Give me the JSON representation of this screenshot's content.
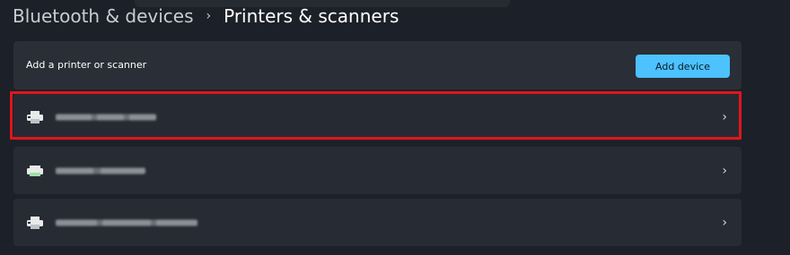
{
  "breadcrumb": {
    "parent": "Bluetooth & devices",
    "separator": "›",
    "current": "Printers & scanners"
  },
  "add_section": {
    "label": "Add a printer or scanner",
    "button_label": "Add device"
  },
  "devices": [
    {
      "name": "",
      "name_redacted": true,
      "icon": "printer-icon",
      "chevron": "›",
      "highlighted": true
    },
    {
      "name": "",
      "name_redacted": true,
      "icon": "printer-icon",
      "chevron": "›",
      "highlighted": false
    },
    {
      "name": "",
      "name_redacted": true,
      "icon": "printer-icon",
      "chevron": "›",
      "highlighted": false
    }
  ],
  "colors": {
    "accent": "#4cc2ff",
    "highlight": "#e0161b",
    "background": "#1c2028",
    "card": "#272b33"
  }
}
